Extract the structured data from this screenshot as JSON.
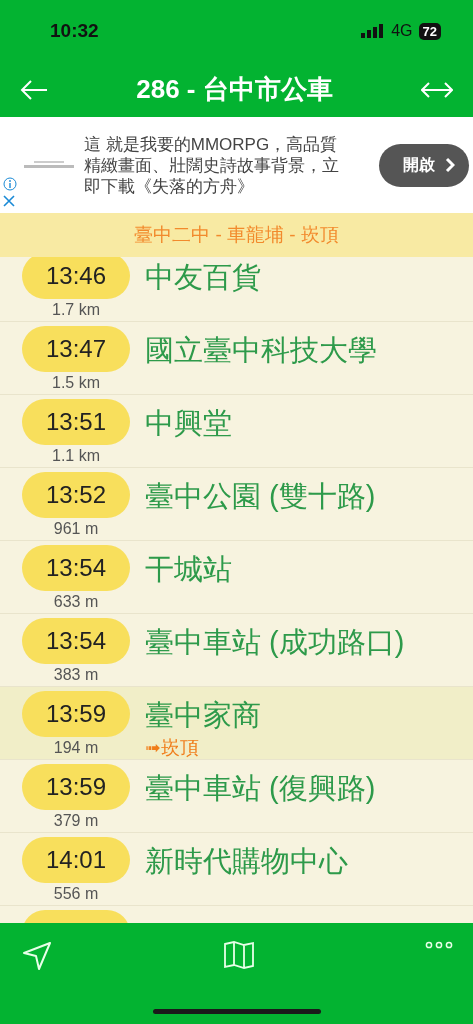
{
  "status_bar": {
    "time": "10:32",
    "network": "4G",
    "battery": "72"
  },
  "header": {
    "title": "286 - 台中市公車"
  },
  "ad": {
    "text": "這 就是我要的MMORPG，高品質精緻畫面、壯闊史詩故事背景，立即下載《失落的方舟》",
    "button": "開啟"
  },
  "direction": {
    "label": "臺中二中 - 車龍埔 - 崁頂"
  },
  "stops": [
    {
      "time": "13:46",
      "distance": "1.7 km",
      "name": "中友百貨",
      "highlighted": false
    },
    {
      "time": "13:47",
      "distance": "1.5 km",
      "name": "國立臺中科技大學",
      "highlighted": false
    },
    {
      "time": "13:51",
      "distance": "1.1 km",
      "name": "中興堂",
      "highlighted": false
    },
    {
      "time": "13:52",
      "distance": "961 m",
      "name": "臺中公園 (雙十路)",
      "highlighted": false
    },
    {
      "time": "13:54",
      "distance": "633 m",
      "name": "干城站",
      "highlighted": false
    },
    {
      "time": "13:54",
      "distance": "383 m",
      "name": "臺中車站 (成功路口)",
      "highlighted": false
    },
    {
      "time": "13:59",
      "distance": "194 m",
      "name": "臺中家商",
      "highlighted": true,
      "note": "➟崁頂"
    },
    {
      "time": "13:59",
      "distance": "379 m",
      "name": "臺中車站 (復興路)",
      "highlighted": false
    },
    {
      "time": "14:01",
      "distance": "556 m",
      "name": "新時代購物中心",
      "highlighted": false
    },
    {
      "highlighted": false
    }
  ]
}
